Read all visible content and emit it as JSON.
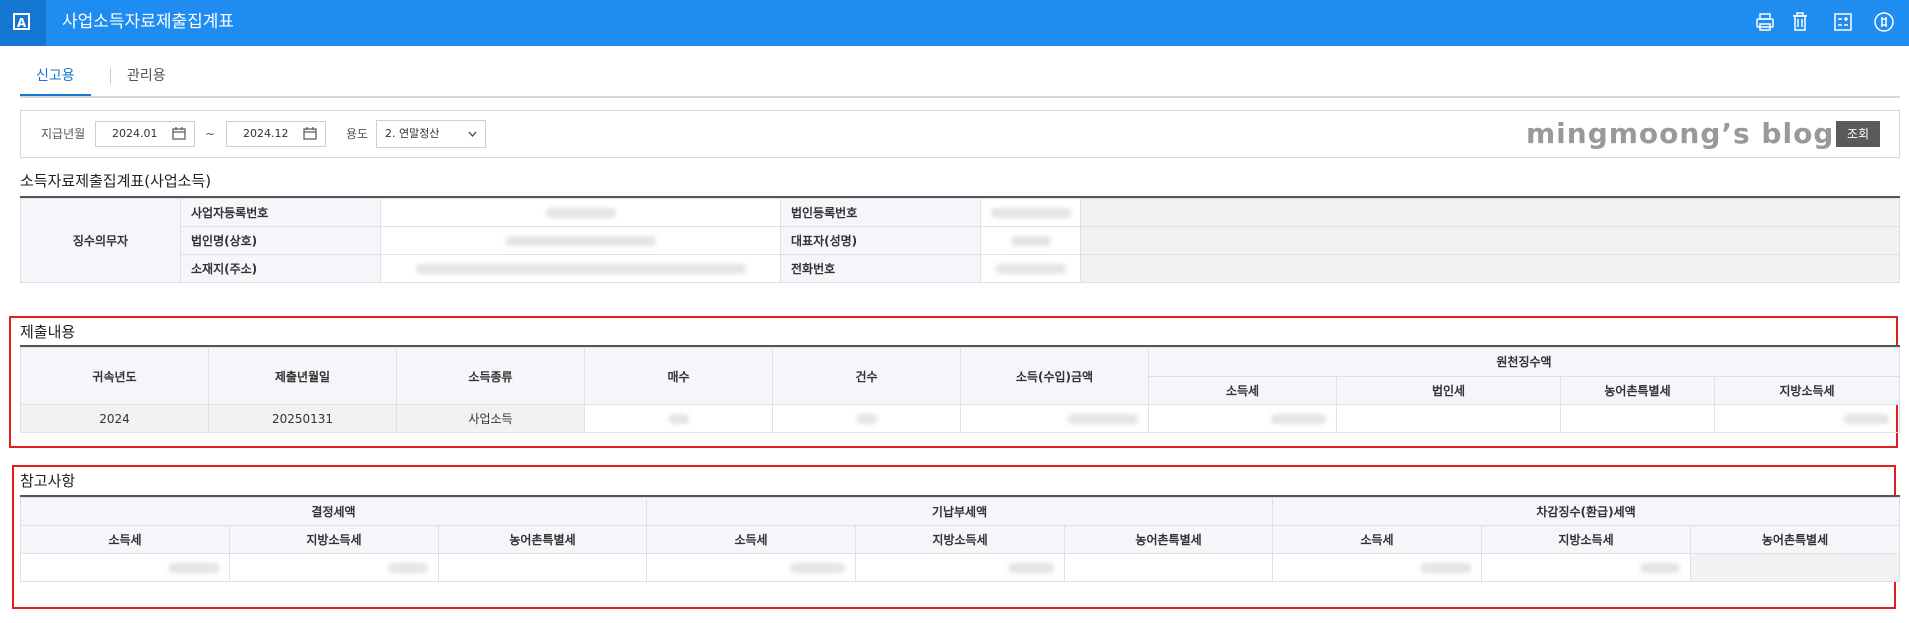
{
  "app": {
    "title": "사업소득자료제출집계표",
    "icon_letter": "A"
  },
  "toolbar_icons": [
    "print-icon",
    "trash-icon",
    "calculator-icon",
    "more-icon"
  ],
  "tabs": [
    {
      "label": "신고용",
      "active": true
    },
    {
      "label": "관리용",
      "active": false
    }
  ],
  "filter": {
    "period_label": "지급년월",
    "date_from": "2024.01",
    "range_sep": "~",
    "date_to": "2024.12",
    "purpose_label": "용도",
    "purpose_value": "2. 연말정산",
    "watermark": "mingmoong’s blog",
    "query_button": "조회"
  },
  "summary": {
    "title": "소득자료제출집계표(사업소득)",
    "withholder_label": "징수의무자",
    "labels": {
      "biz_reg_no": "사업자등록번호",
      "corp_reg_no": "법인등록번호",
      "corp_name": "법인명(상호)",
      "representative": "대표자(성명)",
      "address": "소재지(주소)",
      "phone": "전화번호"
    }
  },
  "submission": {
    "title": "제출내용",
    "headers": {
      "year": "귀속년도",
      "submit_date": "제출년월일",
      "income_type": "소득종류",
      "sheets": "매수",
      "count": "건수",
      "amount": "소득(수입)금액",
      "withholding": "원천징수액",
      "income_tax": "소득세",
      "corp_tax": "법인세",
      "rural_tax": "농어촌특별세",
      "local_tax": "지방소득세"
    },
    "row": {
      "year": "2024",
      "submit_date": "20250131",
      "income_type": "사업소득"
    }
  },
  "reference": {
    "title": "참고사항",
    "groups": {
      "decided": "결정세액",
      "paid": "기납부세액",
      "diff": "차감징수(환급)세액"
    },
    "sub": {
      "income_tax": "소득세",
      "local_tax": "지방소득세",
      "rural_tax": "농어촌특별세"
    }
  },
  "colors": {
    "titlebar": "#1e8cf0",
    "accent": "#1677d2",
    "highlight": "#e0201c"
  }
}
